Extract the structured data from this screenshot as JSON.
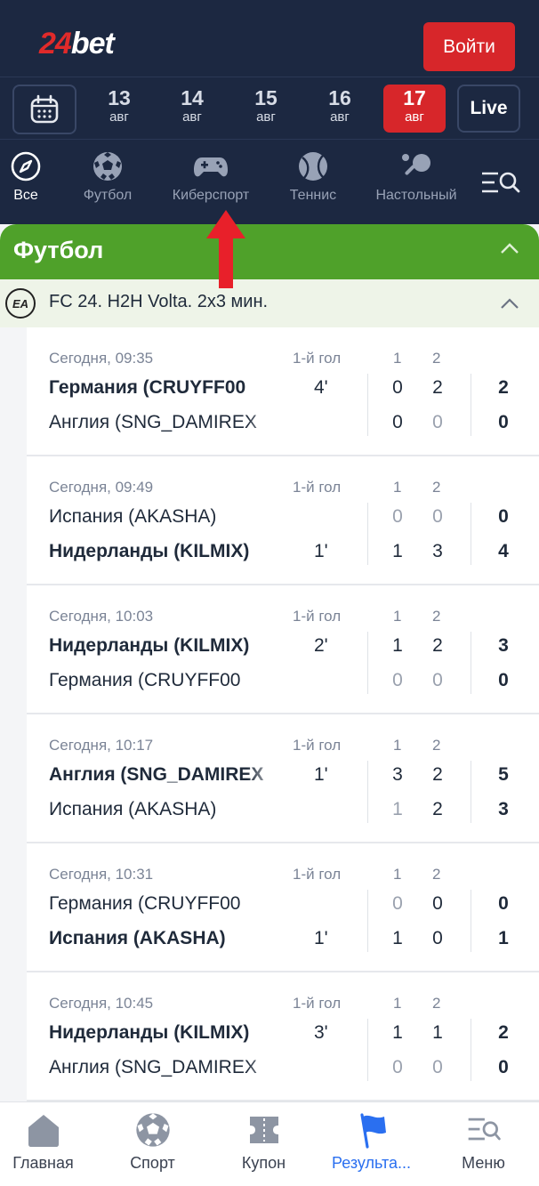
{
  "header": {
    "logo_number": "24",
    "logo_text": "bet",
    "login_label": "Войти"
  },
  "datebar": {
    "calendar_icon": "calendar-icon",
    "dates": [
      {
        "day": "13",
        "month": "авг"
      },
      {
        "day": "14",
        "month": "авг"
      },
      {
        "day": "15",
        "month": "авг"
      },
      {
        "day": "16",
        "month": "авг"
      },
      {
        "day": "17",
        "month": "авг",
        "active": true
      }
    ],
    "live_label": "Live"
  },
  "sports": [
    {
      "label": "Все",
      "icon": "compass-icon",
      "active": true
    },
    {
      "label": "Футбол",
      "icon": "soccer-ball-icon"
    },
    {
      "label": "Киберспорт",
      "icon": "gamepad-icon"
    },
    {
      "label": "Теннис",
      "icon": "tennis-ball-icon"
    },
    {
      "label": "Настольный",
      "icon": "table-tennis-icon"
    }
  ],
  "section": {
    "title": "Футбол",
    "league_logo": "EA",
    "league_title": "FC 24. H2H Volta. 2x3 мин."
  },
  "matches": [
    {
      "time": "Сегодня, 09:35",
      "event_label": "1-й гол",
      "h1": "1",
      "h2": "2",
      "team1": "Германия (CRUYFF00",
      "team2": "Англия (SNG_DAMIREX",
      "min1": "4'",
      "min2": "",
      "s1": [
        "0",
        "2"
      ],
      "s2": [
        "0",
        "0"
      ],
      "tot1": "2",
      "tot2": "0",
      "win": 1
    },
    {
      "time": "Сегодня, 09:49",
      "event_label": "1-й гол",
      "h1": "1",
      "h2": "2",
      "team1": "Испания (AKASHA)",
      "team2": "Нидерланды (KILMIX)",
      "min1": "",
      "min2": "1'",
      "s1": [
        "0",
        "0"
      ],
      "s2": [
        "1",
        "3"
      ],
      "tot1": "0",
      "tot2": "4",
      "win": 2
    },
    {
      "time": "Сегодня, 10:03",
      "event_label": "1-й гол",
      "h1": "1",
      "h2": "2",
      "team1": "Нидерланды (KILMIX)",
      "team2": "Германия (CRUYFF00",
      "min1": "2'",
      "min2": "",
      "s1": [
        "1",
        "2"
      ],
      "s2": [
        "0",
        "0"
      ],
      "tot1": "3",
      "tot2": "0",
      "win": 1
    },
    {
      "time": "Сегодня, 10:17",
      "event_label": "1-й гол",
      "h1": "1",
      "h2": "2",
      "team1": "Англия (SNG_DAMIREX",
      "team2": "Испания (AKASHA)",
      "min1": "1'",
      "min2": "",
      "s1": [
        "3",
        "2"
      ],
      "s2": [
        "1",
        "2"
      ],
      "tot1": "5",
      "tot2": "3",
      "win": 1
    },
    {
      "time": "Сегодня, 10:31",
      "event_label": "1-й гол",
      "h1": "1",
      "h2": "2",
      "team1": "Германия (CRUYFF00",
      "team2": "Испания (AKASHA)",
      "min1": "",
      "min2": "1'",
      "s1": [
        "0",
        "0"
      ],
      "s2": [
        "1",
        "0"
      ],
      "tot1": "0",
      "tot2": "1",
      "win": 2
    },
    {
      "time": "Сегодня, 10:45",
      "event_label": "1-й гол",
      "h1": "1",
      "h2": "2",
      "team1": "Нидерланды (KILMIX)",
      "team2": "Англия (SNG_DAMIREX",
      "min1": "3'",
      "min2": "",
      "s1": [
        "1",
        "1"
      ],
      "s2": [
        "0",
        "0"
      ],
      "tot1": "2",
      "tot2": "0",
      "win": 1
    }
  ],
  "bottom_nav": [
    {
      "label": "Главная",
      "icon": "home-icon"
    },
    {
      "label": "Спорт",
      "icon": "soccer-ball-icon"
    },
    {
      "label": "Купон",
      "icon": "coupon-icon"
    },
    {
      "label": "Результа...",
      "icon": "flag-icon",
      "active": true
    },
    {
      "label": "Меню",
      "icon": "menu-icon"
    }
  ],
  "colors": {
    "header_bg": "#1c2841",
    "accent_red": "#d7262a",
    "section_green": "#4fa12a",
    "active_blue": "#2a6ff0"
  }
}
